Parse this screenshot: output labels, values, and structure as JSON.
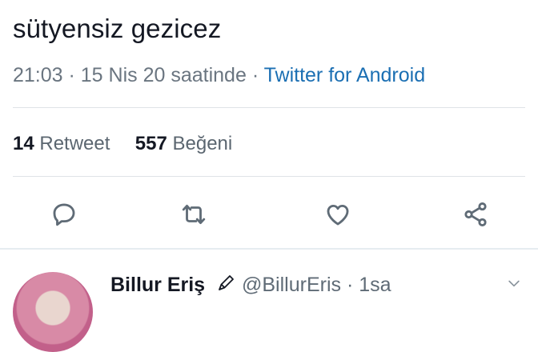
{
  "tweet": {
    "cut_line": "",
    "text": "sütyensiz gezicez",
    "time": "21:03",
    "separator": " · ",
    "date_phrase": "15 Nis 20 saatinde",
    "source": "Twitter for Android"
  },
  "stats": {
    "retweet_count": "14",
    "retweet_label": "Retweet",
    "like_count": "557",
    "like_label": "Beğeni"
  },
  "actions": [
    "reply-icon",
    "retweet-icon",
    "like-icon",
    "share-icon"
  ],
  "reply": {
    "name": "Billur Eriş",
    "handle": "@BillurEris",
    "time_sep": " · ",
    "time": "1sa"
  },
  "colors": {
    "text": "#141823",
    "muted": "#6a7580",
    "link": "#1b6fb3",
    "divider": "#dfe3e7"
  }
}
